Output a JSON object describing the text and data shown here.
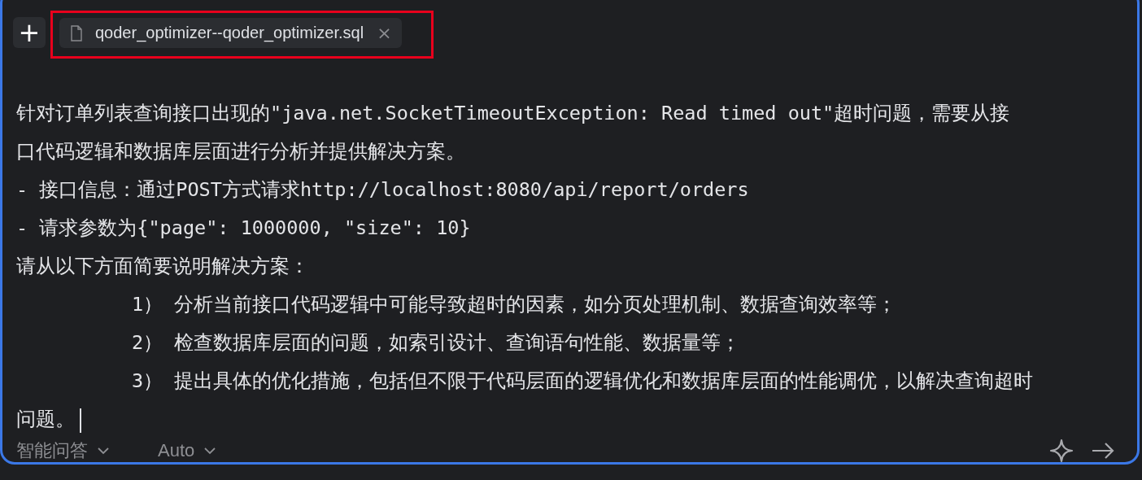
{
  "toolbar": {
    "add_label": "+",
    "tab": {
      "title": "qoder_optimizer--qoder_optimizer.sql",
      "close": "×"
    }
  },
  "prompt": {
    "lines": [
      {
        "kind": "plain",
        "text": "针对订单列表查询接口出现的\"java.net.SocketTimeoutException: Read timed out\"超时问题，需要从接"
      },
      {
        "kind": "plain",
        "text": "口代码逻辑和数据库层面进行分析并提供解决方案。"
      },
      {
        "kind": "plain",
        "text": "- 接口信息：通过POST方式请求http://localhost:8080/api/report/orders"
      },
      {
        "kind": "plain",
        "text": "- 请求参数为{\"page\": 1000000, \"size\": 10}"
      },
      {
        "kind": "plain",
        "text": "请从以下方面简要说明解决方案："
      },
      {
        "kind": "indented",
        "text": "1） 分析当前接口代码逻辑中可能导致超时的因素，如分页处理机制、数据查询效率等；"
      },
      {
        "kind": "indented",
        "text": "2） 检查数据库层面的问题，如索引设计、查询语句性能、数据量等；"
      },
      {
        "kind": "indented",
        "text": "3） 提出具体的优化措施，包括但不限于代码层面的逻辑优化和数据库层面的性能调优，以解决查询超时"
      },
      {
        "kind": "plain",
        "text": "问题。"
      }
    ]
  },
  "footer": {
    "mode": "智能问答",
    "model": "Auto"
  }
}
